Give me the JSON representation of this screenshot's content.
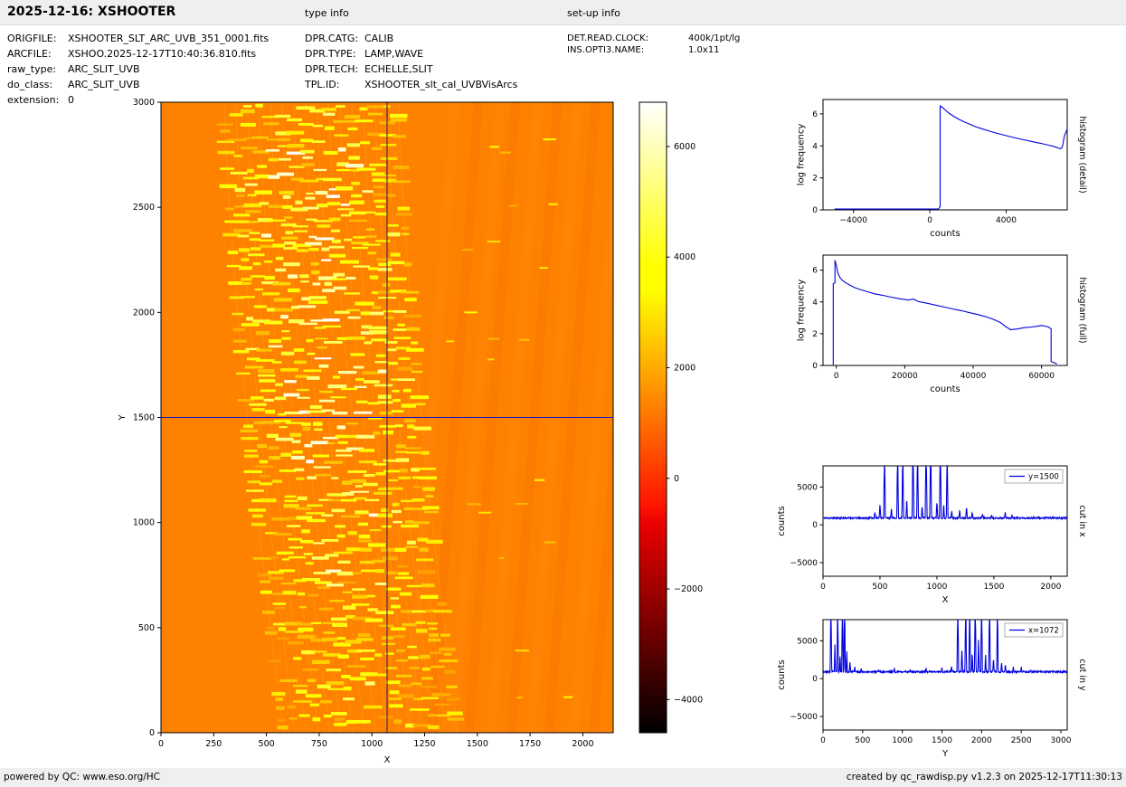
{
  "header": {
    "title": "2025-12-16: XSHOOTER",
    "type_info_label": "type info",
    "setup_info_label": "set-up info"
  },
  "file_info": {
    "rows": [
      {
        "label": "ORIGFILE:",
        "value": "XSHOOTER_SLT_ARC_UVB_351_0001.fits"
      },
      {
        "label": "ARCFILE:",
        "value": "XSHOO.2025-12-17T10:40:36.810.fits"
      },
      {
        "label": "raw_type:",
        "value": "ARC_SLIT_UVB"
      },
      {
        "label": "do_class:",
        "value": "ARC_SLIT_UVB"
      },
      {
        "label": "extension:",
        "value": "0"
      }
    ]
  },
  "type_info": {
    "rows": [
      {
        "label": "DPR.CATG:",
        "value": "CALIB"
      },
      {
        "label": "DPR.TYPE:",
        "value": "LAMP,WAVE"
      },
      {
        "label": "DPR.TECH:",
        "value": "ECHELLE,SLIT"
      },
      {
        "label": "TPL.ID:",
        "value": "XSHOOTER_slt_cal_UVBVisArcs"
      }
    ]
  },
  "setup_info": {
    "rows": [
      {
        "label": "DET.READ.CLOCK:",
        "value": "400k/1pt/lg"
      },
      {
        "label": "INS.OPTI3.NAME:",
        "value": "1.0x11"
      }
    ]
  },
  "footer": {
    "left": "powered by QC: www.eso.org/HC",
    "right": "created by qc_rawdisp.py v1.2.3 on 2025-12-17T11:30:13"
  },
  "chart_data": [
    {
      "id": "raw_frame",
      "type": "heatmap",
      "xlabel": "X",
      "ylabel": "Y",
      "xlim": [
        0,
        2144
      ],
      "ylim": [
        0,
        3000
      ],
      "xticks": [
        0,
        250,
        500,
        750,
        1000,
        1250,
        1500,
        1750,
        2000
      ],
      "yticks": [
        0,
        500,
        1000,
        1500,
        2000,
        2500,
        3000
      ],
      "vmin": -4600,
      "vmax": 6800,
      "background_counts": 1300,
      "n_orders": 16,
      "colormap": "hot",
      "crosshair": {
        "x": 1072,
        "y": 1500
      },
      "description": "Raw XSHOOTER UVB arc-lamp echelle exposure: ~16 tilted/curved spectral orders made of short bright emission-line segments (yellow to white, up to ~6800 counts) on an ~1300-count orange background; blue horizontal cursor line at y=1500 and dark vertical cursor line at x=1072; sparse faint lines to the right of the order bundle."
    },
    {
      "id": "colorbar",
      "type": "colorbar",
      "colormap": "hot",
      "vmin": -4600,
      "vmax": 6800,
      "ticks": [
        6000,
        4000,
        2000,
        0,
        -2000,
        -4000
      ]
    },
    {
      "id": "histogram_detail",
      "type": "line",
      "side_label": "histogram (detail)",
      "xlabel": "counts",
      "ylabel": "log frequency",
      "xlim": [
        -5600,
        7200
      ],
      "ylim": [
        0,
        6.9
      ],
      "xticks": [
        -4000,
        0,
        4000
      ],
      "yticks": [
        0,
        2,
        4,
        6
      ],
      "color": "#0000dd",
      "x": [
        -5000,
        450,
        540,
        540,
        650,
        800,
        1000,
        1250,
        1500,
        1800,
        2100,
        2400,
        2700,
        3000,
        3400,
        3800,
        4200,
        4600,
        5000,
        5400,
        5800,
        6200,
        6500,
        6700,
        6850,
        6950,
        7050,
        7200
      ],
      "y": [
        0.05,
        0.05,
        0.2,
        6.5,
        6.42,
        6.25,
        6.05,
        5.85,
        5.68,
        5.5,
        5.35,
        5.2,
        5.08,
        4.97,
        4.83,
        4.7,
        4.58,
        4.47,
        4.36,
        4.26,
        4.16,
        4.05,
        3.97,
        3.88,
        3.82,
        3.95,
        4.6,
        5.05
      ]
    },
    {
      "id": "histogram_full",
      "type": "line",
      "side_label": "histogram (full)",
      "xlabel": "counts",
      "ylabel": "log frequency",
      "xlim": [
        -3900,
        67500
      ],
      "ylim": [
        0,
        6.95
      ],
      "xticks": [
        0,
        20000,
        40000,
        60000
      ],
      "yticks": [
        0,
        2,
        4,
        6
      ],
      "color": "#0000dd",
      "x": [
        -900,
        -900,
        -400,
        -400,
        0,
        400,
        1000,
        1800,
        2800,
        4000,
        5400,
        7000,
        9000,
        11000,
        13500,
        16000,
        18500,
        21000,
        22500,
        24000,
        26500,
        29000,
        31500,
        34000,
        36500,
        39000,
        41500,
        44000,
        46000,
        48000,
        49500,
        51000,
        53000,
        55000,
        57000,
        58500,
        60000,
        61000,
        62000,
        62800,
        62800,
        64500
      ],
      "y": [
        0,
        5.15,
        5.2,
        6.62,
        6.3,
        5.85,
        5.55,
        5.35,
        5.2,
        5.05,
        4.9,
        4.78,
        4.65,
        4.52,
        4.42,
        4.3,
        4.2,
        4.12,
        4.18,
        4.02,
        3.92,
        3.8,
        3.68,
        3.56,
        3.45,
        3.32,
        3.2,
        3.05,
        2.9,
        2.7,
        2.45,
        2.25,
        2.3,
        2.38,
        2.42,
        2.46,
        2.52,
        2.48,
        2.42,
        2.3,
        0.25,
        0.1
      ]
    },
    {
      "id": "cut_in_x",
      "type": "line",
      "side_label": "cut in x",
      "legend": "y=1500",
      "xlabel": "X",
      "ylabel": "counts",
      "xlim": [
        0,
        2144
      ],
      "ylim": [
        -6800,
        7800
      ],
      "xticks": [
        0,
        500,
        1000,
        1500,
        2000
      ],
      "yticks": [
        -5000,
        0,
        5000
      ],
      "color": "#0000dd",
      "baseline": 900,
      "noise": 110,
      "seed": 11,
      "clip_max": 7800,
      "peaks": [
        [
          455,
          1700,
          7
        ],
        [
          500,
          2900,
          7
        ],
        [
          540,
          12000,
          7
        ],
        [
          600,
          2300,
          6
        ],
        [
          655,
          12000,
          7
        ],
        [
          700,
          12000,
          7
        ],
        [
          735,
          3700,
          6
        ],
        [
          790,
          12000,
          8
        ],
        [
          830,
          12000,
          7
        ],
        [
          870,
          2700,
          6
        ],
        [
          905,
          12000,
          8
        ],
        [
          945,
          12000,
          8
        ],
        [
          1000,
          3300,
          7
        ],
        [
          1030,
          12000,
          8
        ],
        [
          1060,
          2700,
          6
        ],
        [
          1090,
          12000,
          7
        ],
        [
          1130,
          2000,
          6
        ],
        [
          1200,
          2100,
          7
        ],
        [
          1260,
          2500,
          7
        ],
        [
          1310,
          1800,
          6
        ],
        [
          1400,
          1500,
          7
        ],
        [
          1480,
          1350,
          7
        ],
        [
          1600,
          1600,
          8
        ],
        [
          1660,
          1250,
          6
        ]
      ]
    },
    {
      "id": "cut_in_y",
      "type": "line",
      "side_label": "cut in y",
      "legend": "x=1072",
      "xlabel": "Y",
      "ylabel": "counts",
      "xlim": [
        0,
        3080
      ],
      "ylim": [
        -6800,
        7800
      ],
      "xticks": [
        0,
        500,
        1000,
        1500,
        2000,
        2500,
        3000
      ],
      "yticks": [
        -5000,
        0,
        5000
      ],
      "color": "#0000dd",
      "baseline": 900,
      "noise": 110,
      "seed": 23,
      "clip_max": 7800,
      "peaks": [
        [
          100,
          12000,
          10
        ],
        [
          150,
          4600,
          8
        ],
        [
          185,
          12000,
          9
        ],
        [
          215,
          3100,
          8
        ],
        [
          245,
          12000,
          10
        ],
        [
          272,
          12000,
          9
        ],
        [
          300,
          3600,
          8
        ],
        [
          340,
          2300,
          8
        ],
        [
          400,
          1600,
          8
        ],
        [
          480,
          1400,
          8
        ],
        [
          700,
          1300,
          8
        ],
        [
          900,
          1350,
          8
        ],
        [
          1100,
          1300,
          8
        ],
        [
          1300,
          1350,
          8
        ],
        [
          1500,
          1400,
          8
        ],
        [
          1620,
          1600,
          8
        ],
        [
          1700,
          12000,
          10
        ],
        [
          1752,
          4300,
          9
        ],
        [
          1800,
          12000,
          10
        ],
        [
          1850,
          12000,
          9
        ],
        [
          1882,
          3600,
          8
        ],
        [
          1920,
          12000,
          10
        ],
        [
          1962,
          5300,
          9
        ],
        [
          2000,
          12000,
          10
        ],
        [
          2050,
          3300,
          8
        ],
        [
          2100,
          12000,
          10
        ],
        [
          2150,
          2900,
          8
        ],
        [
          2200,
          12000,
          9
        ],
        [
          2252,
          2300,
          8
        ],
        [
          2300,
          1900,
          8
        ],
        [
          2400,
          1600,
          8
        ],
        [
          2500,
          1500,
          8
        ],
        [
          2620,
          1200,
          8
        ]
      ]
    }
  ]
}
